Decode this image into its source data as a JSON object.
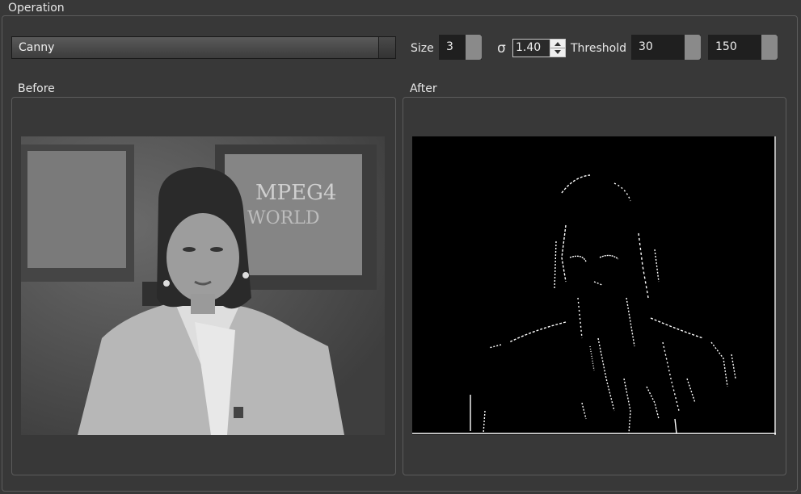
{
  "operation": {
    "group_title": "Operation",
    "mode": "Canny",
    "size_label": "Size",
    "size_value": "3",
    "sigma_label": "σ",
    "sigma_value": "1.40",
    "threshold_label": "Threshold",
    "threshold_low": "30",
    "threshold_high": "150"
  },
  "before": {
    "title": "Before",
    "image": "grayscale-photo-news-anchor"
  },
  "after": {
    "title": "After",
    "image": "canny-edge-map-news-anchor"
  },
  "colors": {
    "background": "#383838",
    "handle": "#8a8a8a",
    "edge": "#ffffff"
  }
}
